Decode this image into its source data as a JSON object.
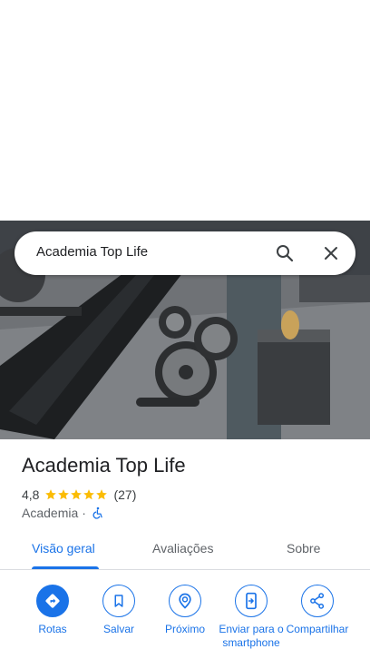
{
  "search": {
    "query": "Academia Top Life"
  },
  "place": {
    "name": "Academia Top Life",
    "rating": "4,8",
    "stars": 5,
    "reviews": "(27)",
    "category": "Academia",
    "separator": "·",
    "accessible": true
  },
  "tabs": [
    {
      "label": "Visão geral",
      "active": true
    },
    {
      "label": "Avaliações",
      "active": false
    },
    {
      "label": "Sobre",
      "active": false
    }
  ],
  "actions": [
    {
      "label": "Rotas",
      "icon": "directions-icon"
    },
    {
      "label": "Salvar",
      "icon": "bookmark-icon"
    },
    {
      "label": "Próximo",
      "icon": "nearby-icon"
    },
    {
      "label": "Enviar para o smartphone",
      "icon": "send-to-phone-icon"
    },
    {
      "label": "Compartilhar",
      "icon": "share-icon"
    }
  ],
  "colors": {
    "accent": "#1a73e8",
    "star": "#fbbc04",
    "text_primary": "#202124",
    "text_secondary": "#5f6368"
  }
}
